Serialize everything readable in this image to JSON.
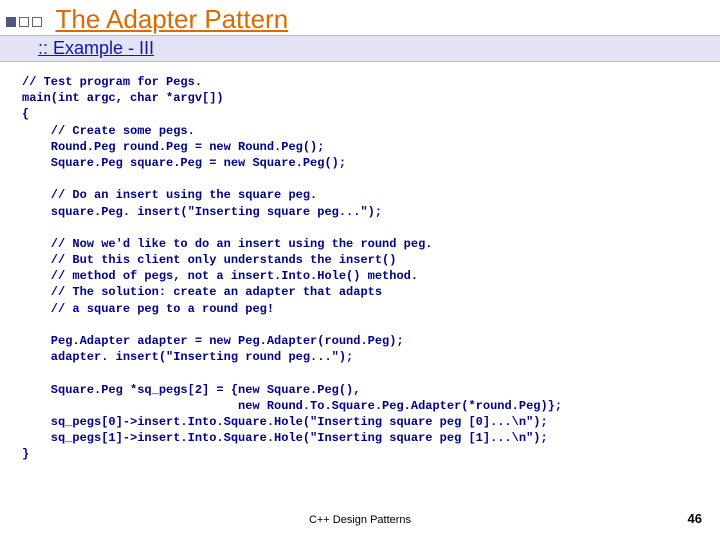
{
  "slide": {
    "title": "The Adapter Pattern",
    "subtitle": ":: Example - III"
  },
  "code": {
    "text": "// Test program for Pegs.\nmain(int argc, char *argv[])\n{\n    // Create some pegs.\n    Round.Peg round.Peg = new Round.Peg();\n    Square.Peg square.Peg = new Square.Peg();\n\n    // Do an insert using the square peg.\n    square.Peg. insert(\"Inserting square peg...\");\n\n    // Now we'd like to do an insert using the round peg.\n    // But this client only understands the insert()\n    // method of pegs, not a insert.Into.Hole() method.\n    // The solution: create an adapter that adapts\n    // a square peg to a round peg!\n\n    Peg.Adapter adapter = new Peg.Adapter(round.Peg);\n    adapter. insert(\"Inserting round peg...\");\n\n    Square.Peg *sq_pegs[2] = {new Square.Peg(),\n                              new Round.To.Square.Peg.Adapter(*round.Peg)};\n    sq_pegs[0]->insert.Into.Square.Hole(\"Inserting square peg [0]...\\n\");\n    sq_pegs[1]->insert.Into.Square.Hole(\"Inserting square peg [1]...\\n\");\n}"
  },
  "footer": {
    "center": "C++ Design Patterns",
    "page": "46"
  }
}
